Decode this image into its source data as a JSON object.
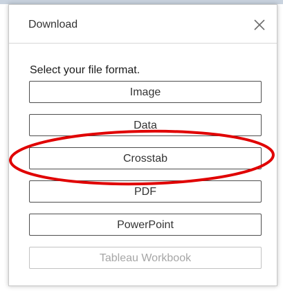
{
  "dialog": {
    "title": "Download",
    "prompt": "Select your file format.",
    "formats": [
      {
        "label": "Image",
        "enabled": true
      },
      {
        "label": "Data",
        "enabled": true
      },
      {
        "label": "Crosstab",
        "enabled": true,
        "highlighted": true
      },
      {
        "label": "PDF",
        "enabled": true
      },
      {
        "label": "PowerPoint",
        "enabled": true
      },
      {
        "label": "Tableau Workbook",
        "enabled": false
      }
    ]
  },
  "icons": {
    "close": "close-icon"
  },
  "colors": {
    "highlight": "#e00000",
    "button_border": "#4d4d4d",
    "disabled_text": "#a6a6a6"
  }
}
